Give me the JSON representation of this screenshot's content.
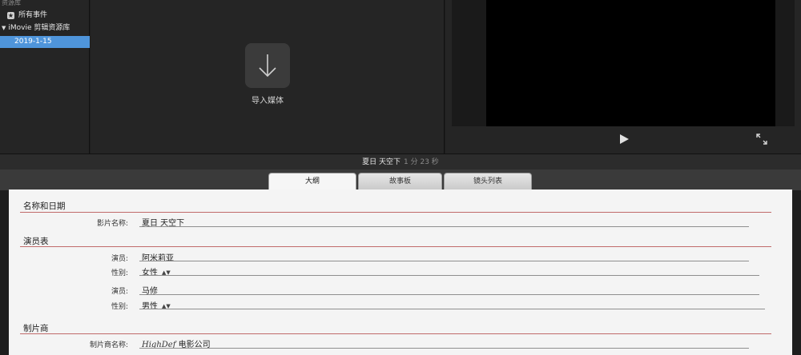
{
  "sidebar": {
    "header": "资源库",
    "items": [
      {
        "label": "所有事件",
        "icon": "star-icon"
      },
      {
        "label": "iMovie 剪辑资源库",
        "icon": "disclosure-triangle-icon"
      },
      {
        "label": "2019-1-15",
        "selected": true
      }
    ]
  },
  "browser": {
    "import_label": "导入媒体",
    "import_icon": "down-arrow-icon"
  },
  "viewer": {
    "play_icon": "play-icon",
    "fullscreen_icon": "fullscreen-icon"
  },
  "project": {
    "title": "夏日 天空下",
    "duration": "1 分 23 秒"
  },
  "tabs": [
    {
      "label": "大纲",
      "active": true
    },
    {
      "label": "故事板",
      "active": false
    },
    {
      "label": "镜头列表",
      "active": false
    }
  ],
  "outline": {
    "name_section": {
      "title": "名称和日期",
      "movie_name_label": "影片名称:",
      "movie_name_value": "夏日 天空下"
    },
    "cast_section": {
      "title": "演员表",
      "cast": [
        {
          "actor_label": "演员:",
          "actor_value": "阿米莉亚",
          "gender_label": "性别:",
          "gender_value": "女性"
        },
        {
          "actor_label": "演员:",
          "actor_value": "马修",
          "gender_label": "性别:",
          "gender_value": "男性"
        }
      ]
    },
    "studio_section": {
      "title": "制片商",
      "studio_name_label": "制片商名称:",
      "studio_logo_text": "HighDef",
      "studio_name_value": "电影公司"
    }
  },
  "colors": {
    "selection": "#4f95db",
    "section_rule": "#c06a6a",
    "doc_background": "#f4f4f4"
  }
}
